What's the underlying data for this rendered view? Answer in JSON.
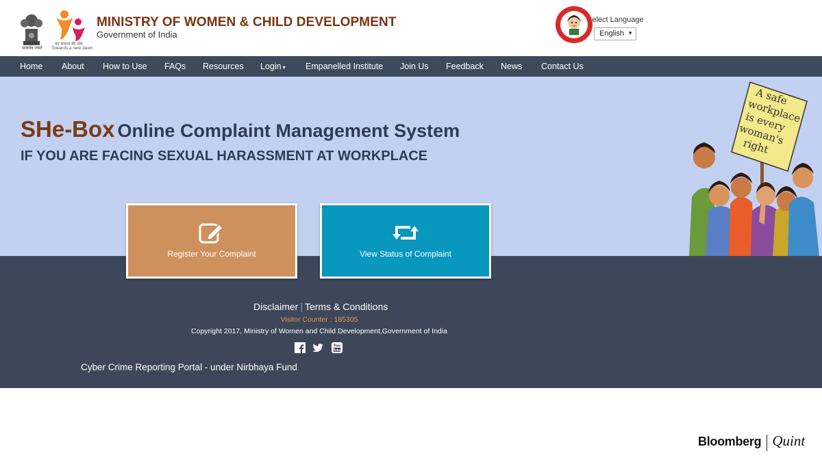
{
  "header": {
    "emblem_text": "सत्यमेव जयते",
    "wcd_tagline_hindi": "नए समाज की ओर",
    "wcd_tagline_english": "Towards a new dawn",
    "ministry_title": "MINISTRY OF WOMEN & CHILD DEVELOPMENT",
    "ministry_subtitle": "Government of India",
    "language_label": "Select Language",
    "language_value": "English"
  },
  "nav": {
    "items": [
      "Home",
      "About",
      "How to Use",
      "FAQs",
      "Resources",
      "Login",
      "Empanelled Institute",
      "Join Us",
      "Feedback",
      "News",
      "Contact Us"
    ]
  },
  "hero": {
    "brand": "SHe-Box",
    "title_rest": "Online Complaint Management System",
    "subtitle": "IF YOU ARE FACING SEXUAL HARASSMENT AT WORKPLACE",
    "placard_lines": [
      "A safe",
      "workplace",
      "is every",
      "woman's",
      "right"
    ]
  },
  "actions": {
    "register_label": "Register Your Complaint",
    "status_label": "View Status of Complaint"
  },
  "footer": {
    "disclaimer": "Disclaimer",
    "terms": "Terms & Conditions",
    "visitor_counter": "Visitor Counter : 185305",
    "copyright": "Copyright 2017, Ministry of Women and Child Development,Government of India",
    "cyber_portal": "Cyber Crime Reporting Portal - under Nirbhaya Fund"
  },
  "watermark": {
    "left": "Bloomberg",
    "right": "Quint"
  },
  "colors": {
    "nav_bg": "#3d4a5c",
    "hero_bg": "#c2d0f2",
    "register_card": "#ce915d",
    "status_card": "#0897bd",
    "visitor_counter": "#e0915c",
    "ministry_title": "#7a3410"
  }
}
